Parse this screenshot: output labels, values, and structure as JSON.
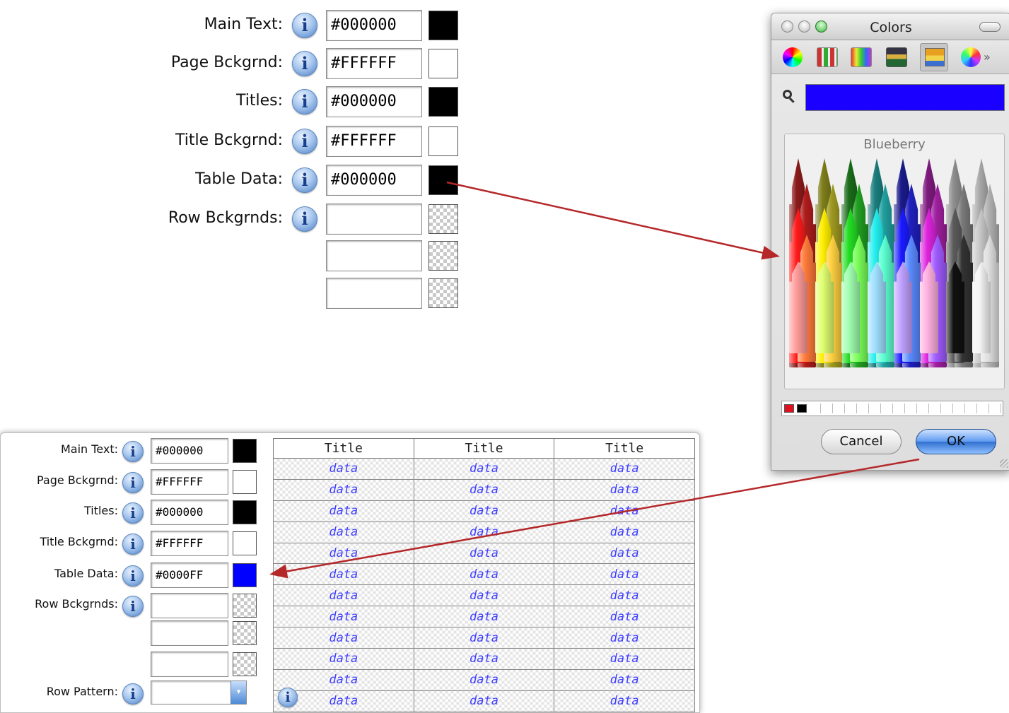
{
  "top_panel": {
    "rows": [
      {
        "label": "Main Text:",
        "value": "#000000",
        "swatch": "#000000"
      },
      {
        "label": "Page Bckgrnd:",
        "value": "#FFFFFF",
        "swatch": "#FFFFFF"
      },
      {
        "label": "Titles:",
        "value": "#000000",
        "swatch": "#000000"
      },
      {
        "label": "Title Bckgrnd:",
        "value": "#FFFFFF",
        "swatch": "#FFFFFF"
      },
      {
        "label": "Table Data:",
        "value": "#000000",
        "swatch": "#000000"
      },
      {
        "label": "Row Bckgrnds:",
        "value": "",
        "swatch": "checker"
      }
    ],
    "extra_row_fields": [
      "",
      ""
    ]
  },
  "colors_window": {
    "title": "Colors",
    "selected_color": "#1A00FF",
    "crayon_name": "Blueberry",
    "cancel_label": "Cancel",
    "ok_label": "OK",
    "more_glyph": "»"
  },
  "bottom_panel": {
    "rows": [
      {
        "label": "Main Text:",
        "value": "#000000",
        "swatch": "#000000"
      },
      {
        "label": "Page Bckgrnd:",
        "value": "#FFFFFF",
        "swatch": "#FFFFFF"
      },
      {
        "label": "Titles:",
        "value": "#000000",
        "swatch": "#000000"
      },
      {
        "label": "Title Bckgrnd:",
        "value": "#FFFFFF",
        "swatch": "#FFFFFF"
      },
      {
        "label": "Table Data:",
        "value": "#0000FF",
        "swatch": "#0000FF"
      },
      {
        "label": "Row Bckgrnds:",
        "value": "",
        "swatch": "checker"
      }
    ],
    "extra_row_fields": [
      "",
      ""
    ],
    "row_pattern_label": "Row Pattern:",
    "row_pattern_value": "",
    "table": {
      "headers": [
        "Title",
        "Title",
        "Title"
      ],
      "cell_text": "data",
      "row_count": 12
    }
  },
  "info_glyph": "i",
  "accent_arrow_color": "#B5282A"
}
